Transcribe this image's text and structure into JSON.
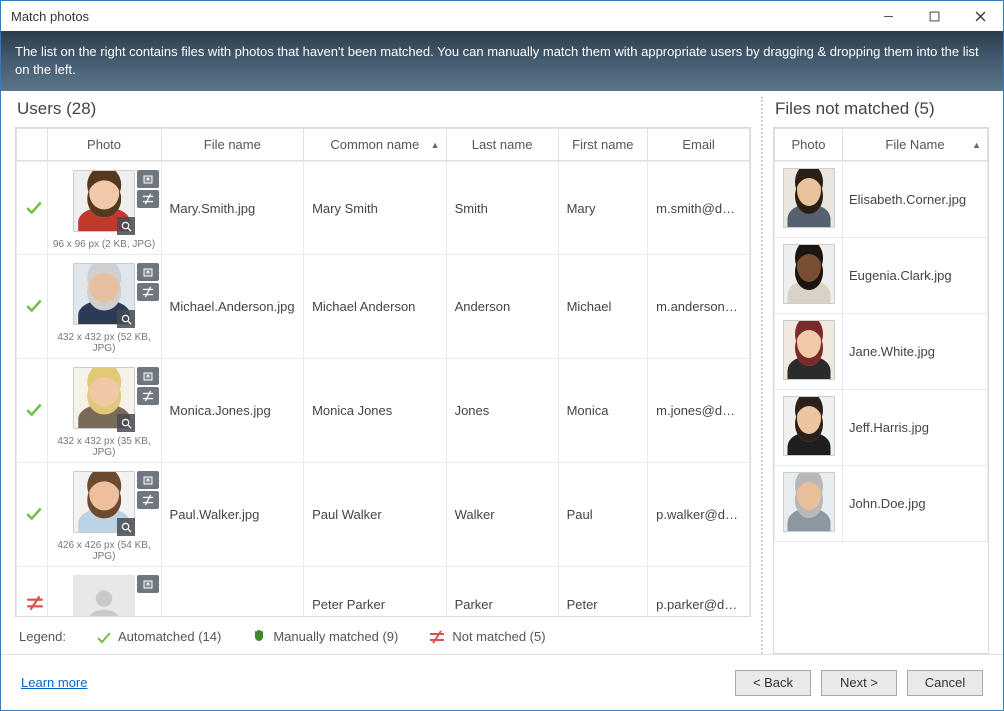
{
  "window": {
    "title": "Match photos"
  },
  "banner": "The list on the right contains files with photos that haven't been matched. You can manually match them with appropriate users by dragging & dropping them into the list on the left.",
  "users": {
    "title": "Users  (28)",
    "headers": {
      "photo": "Photo",
      "file_name": "File name",
      "common_name": "Common name",
      "last_name": "Last name",
      "first_name": "First name",
      "email": "Email"
    },
    "rows": [
      {
        "status": "auto",
        "dim": "96 x 96 px (2 KB, JPG)",
        "file_name": "Mary.Smith.jpg",
        "common_name": "Mary Smith",
        "last_name": "Smith",
        "first_name": "Mary",
        "email": "m.smith@dstdomain.com",
        "has_photo": true,
        "skin": "#f2c9a8",
        "hair": "#54381f",
        "bust": "#c0392b",
        "bg": "#eeeeee"
      },
      {
        "status": "auto",
        "dim": "432 x 432 px (52 KB, JPG)",
        "file_name": "Michael.Anderson.jpg",
        "common_name": "Michael Anderson",
        "last_name": "Anderson",
        "first_name": "Michael",
        "email": "m.anderson@dstdomain.com",
        "has_photo": true,
        "skin": "#e8bfa0",
        "hair": "#cfcfcf",
        "bust": "#2b3a55",
        "bg": "#dfe6ec"
      },
      {
        "status": "auto",
        "dim": "432 x 432 px (35 KB, JPG)",
        "file_name": "Monica.Jones.jpg",
        "common_name": "Monica Jones",
        "last_name": "Jones",
        "first_name": "Monica",
        "email": "m.jones@dstdomain.com",
        "has_photo": true,
        "skin": "#f0c8a6",
        "hair": "#e2c97a",
        "bust": "#7a6a58",
        "bg": "#f5f2ea"
      },
      {
        "status": "auto",
        "dim": "426 x 426 px (54 KB, JPG)",
        "file_name": "Paul.Walker.jpg",
        "common_name": "Paul Walker",
        "last_name": "Walker",
        "first_name": "Paul",
        "email": "p.walker@dstdomain.com",
        "has_photo": true,
        "skin": "#eebf9d",
        "hair": "#6c4a2f",
        "bust": "#bcd3e6",
        "bg": "#f2f2f2"
      },
      {
        "status": "none",
        "dim": "",
        "file_name": "",
        "common_name": "Peter Parker",
        "last_name": "Parker",
        "first_name": "Peter",
        "email": "p.parker@dstdomain.com",
        "has_photo": false
      }
    ]
  },
  "unmatched": {
    "title": "Files not matched (5)",
    "headers": {
      "photo": "Photo",
      "file_name": "File Name"
    },
    "rows": [
      {
        "file_name": "Elisabeth.Corner.jpg",
        "skin": "#e7c29a",
        "hair": "#2a1d14",
        "bust": "#556070",
        "bg": "#e9e6df"
      },
      {
        "file_name": "Eugenia.Clark.jpg",
        "skin": "#7a4e33",
        "hair": "#1c140e",
        "bust": "#d9d2c8",
        "bg": "#eeeeee"
      },
      {
        "file_name": "Jane.White.jpg",
        "skin": "#f1cba8",
        "hair": "#7b2a2a",
        "bust": "#2b2b2b",
        "bg": "#efe8df"
      },
      {
        "file_name": "Jeff.Harris.jpg",
        "skin": "#ecc4a0",
        "hair": "#2c2018",
        "bust": "#1e1e1e",
        "bg": "#f0f0f0"
      },
      {
        "file_name": "John.Doe.jpg",
        "skin": "#e9bf9c",
        "hair": "#b8b8b8",
        "bust": "#8d97a2",
        "bg": "#e7ecef"
      }
    ]
  },
  "legend": {
    "label": "Legend:",
    "auto": "Automatched (14)",
    "manual": "Manually matched (9)",
    "none": "Not matched (5)"
  },
  "footer": {
    "learn": "Learn more",
    "back": "<  Back",
    "next": "Next  >",
    "cancel": "Cancel"
  }
}
